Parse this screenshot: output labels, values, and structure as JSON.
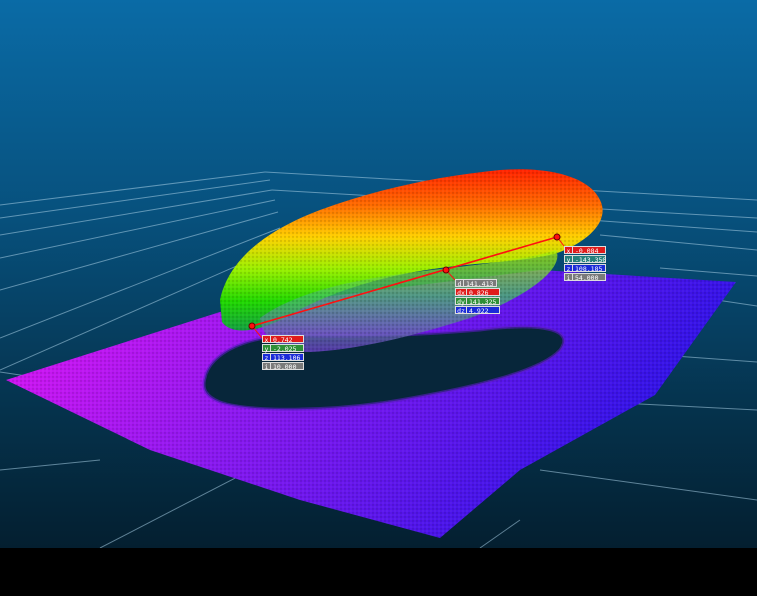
{
  "measurements": {
    "point_a": {
      "rows": [
        {
          "key": "x",
          "value": "0,742",
          "color": "#e01b1b"
        },
        {
          "key": "y",
          "value": "-2,025",
          "color": "#2e8f36"
        },
        {
          "key": "z",
          "value": "113,106",
          "color": "#1b2bd8"
        },
        {
          "key": "i",
          "value": "10,000",
          "color": "#7a7a7a"
        }
      ]
    },
    "distance": {
      "rows": [
        {
          "key": "d",
          "value": "141,413",
          "color": "#7a7a7a"
        },
        {
          "key": "dx",
          "value": "0,826",
          "color": "#e01b1b"
        },
        {
          "key": "dy",
          "value": "141,325",
          "color": "#2e8f36"
        },
        {
          "key": "dz",
          "value": "4,922",
          "color": "#1b2bd8"
        }
      ]
    },
    "point_b": {
      "rows": [
        {
          "key": "x",
          "value": "-0,084",
          "color": "#e01b1b"
        },
        {
          "key": "y",
          "value": "-143,350",
          "color": "#26807a"
        },
        {
          "key": "z",
          "value": "108,185",
          "color": "#1b2bd8"
        },
        {
          "key": "i",
          "value": "54,000",
          "color": "#7a7a7a"
        }
      ]
    }
  },
  "colors": {
    "background_top": "#0a6ba6",
    "background_bottom": "#041f30",
    "ground_left": "#e010f0",
    "ground_right": "#2a10e8",
    "dome_top": "#ff3000",
    "dome_bottom": "#30e000",
    "measure_line": "#ff1010"
  }
}
